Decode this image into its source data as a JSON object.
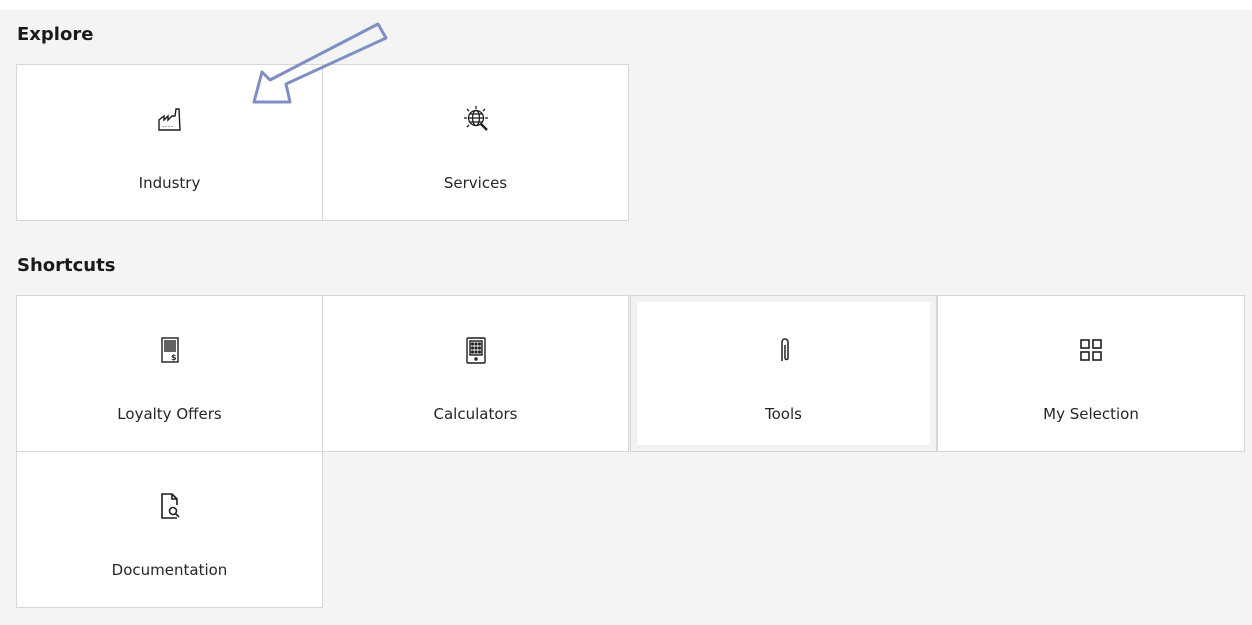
{
  "explore": {
    "title": "Explore",
    "tiles": [
      {
        "label": "Industry",
        "icon": "factory-icon"
      },
      {
        "label": "Services",
        "icon": "globe-gear-icon"
      }
    ]
  },
  "shortcuts": {
    "title": "Shortcuts",
    "tiles": [
      {
        "label": "Loyalty Offers",
        "icon": "invoice-dollar-icon"
      },
      {
        "label": "Calculators",
        "icon": "calculator-icon"
      },
      {
        "label": "Tools",
        "icon": "paperclip-icon"
      },
      {
        "label": "My Selection",
        "icon": "grid-icon"
      },
      {
        "label": "Documentation",
        "icon": "document-search-icon"
      }
    ]
  },
  "colors": {
    "background": "#f4f4f4",
    "tile": "#ffffff",
    "border": "#d6d6d6",
    "arrow": "#7f8fc4"
  }
}
